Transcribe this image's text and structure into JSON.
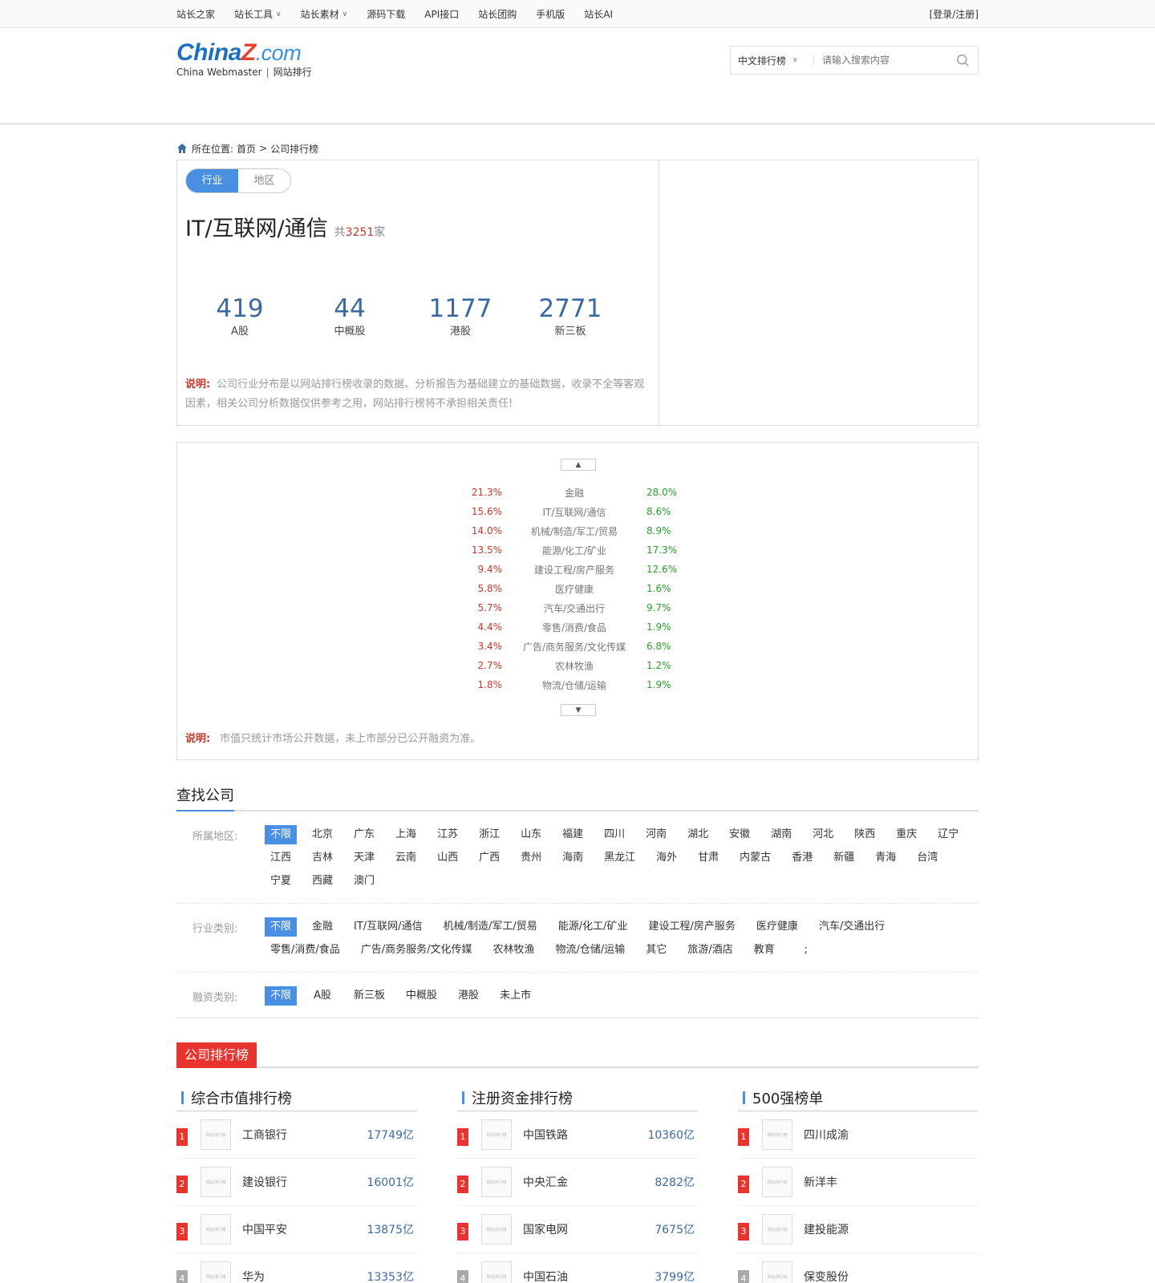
{
  "topnav": {
    "items": [
      {
        "label": "站长之家",
        "caret": false
      },
      {
        "label": "站长工具",
        "caret": true
      },
      {
        "label": "站长素材",
        "caret": true
      },
      {
        "label": "源码下载",
        "caret": false
      },
      {
        "label": "API接口",
        "caret": false
      },
      {
        "label": "站长团购",
        "caret": false
      },
      {
        "label": "手机版",
        "caret": false
      },
      {
        "label": "站长AI",
        "caret": false
      }
    ],
    "login": "[登录/注册]"
  },
  "logo": {
    "china": "China",
    "z": "Z",
    "dotcom": ".com",
    "sub_left": "China Webmaster",
    "sub_sep": "|",
    "sub_right": "网站排行"
  },
  "search": {
    "type": "中文排行榜",
    "placeholder": "请输入搜索内容"
  },
  "breadcrumb": {
    "prefix": "所在位置:",
    "home": "首页",
    "sep": ">",
    "current": "公司排行榜"
  },
  "summary": {
    "tabs": [
      {
        "label": "行业",
        "active": true
      },
      {
        "label": "地区",
        "active": false
      }
    ],
    "title": "IT/互联网/通信",
    "total_prefix": "共",
    "total_num": "3251",
    "total_suffix": "家",
    "stats": [
      {
        "value": "419",
        "label": "A股"
      },
      {
        "value": "44",
        "label": "中概股"
      },
      {
        "value": "1177",
        "label": "港股"
      },
      {
        "value": "2771",
        "label": "新三板"
      }
    ],
    "note_label": "说明:",
    "note_text": "公司行业分布是以网站排行榜收录的数据、分析报告为基础建立的基础数据，收录不全等客观因素，相关公司分析数据仅供参考之用，网站排行榜将不承担相关责任!"
  },
  "distribution": {
    "rows": [
      {
        "left": "21.3%",
        "name": "金融",
        "right": "28.0%"
      },
      {
        "left": "15.6%",
        "name": "IT/互联网/通信",
        "right": "8.6%"
      },
      {
        "left": "14.0%",
        "name": "机械/制造/军工/贸易",
        "right": "8.9%"
      },
      {
        "left": "13.5%",
        "name": "能源/化工/矿业",
        "right": "17.3%"
      },
      {
        "left": "9.4%",
        "name": "建设工程/房产服务",
        "right": "12.6%"
      },
      {
        "left": "5.8%",
        "name": "医疗健康",
        "right": "1.6%"
      },
      {
        "left": "5.7%",
        "name": "汽车/交通出行",
        "right": "9.7%"
      },
      {
        "left": "4.4%",
        "name": "零售/消费/食品",
        "right": "1.9%"
      },
      {
        "left": "3.4%",
        "name": "广告/商务服务/文化传媒",
        "right": "6.8%"
      },
      {
        "left": "2.7%",
        "name": "农林牧渔",
        "right": "1.2%"
      },
      {
        "left": "1.8%",
        "name": "物流/仓储/运输",
        "right": "1.9%"
      }
    ],
    "note_label": "说明:",
    "note_text": "市值只统计市场公开数据，未上市部分已公开融资为准。"
  },
  "find": {
    "title": "查找公司",
    "region_label": "所属地区:",
    "regions": [
      "不限",
      "北京",
      "广东",
      "上海",
      "江苏",
      "浙江",
      "山东",
      "福建",
      "四川",
      "河南",
      "湖北",
      "安徽",
      "湖南",
      "河北",
      "陕西",
      "重庆",
      "辽宁",
      "江西",
      "吉林",
      "天津",
      "云南",
      "山西",
      "广西",
      "贵州",
      "海南",
      "黑龙江",
      "海外",
      "甘肃",
      "内蒙古",
      "香港",
      "新疆",
      "青海",
      "台湾",
      "宁夏",
      "西藏",
      "澳门"
    ],
    "industry_label": "行业类别:",
    "industries": [
      "不限",
      "金融",
      "IT/互联网/通信",
      "机械/制造/军工/贸易",
      "能源/化工/矿业",
      "建设工程/房产服务",
      "医疗健康",
      "汽车/交通出行",
      "零售/消费/食品",
      "广告/商务服务/文化传媒",
      "农林牧渔",
      "物流/仓储/运输",
      "其它",
      "旅游/酒店",
      "教育",
      ";"
    ],
    "finance_label": "融资类别:",
    "finances": [
      "不限",
      "A股",
      "新三板",
      "中概股",
      "港股",
      "未上市"
    ]
  },
  "ranking": {
    "head": "公司排行榜",
    "thumb_text": "网站排行榜",
    "columns": [
      {
        "title": "综合市值排行榜",
        "rows": [
          {
            "rank": "1",
            "name": "工商银行",
            "value": "17749亿"
          },
          {
            "rank": "2",
            "name": "建设银行",
            "value": "16001亿"
          },
          {
            "rank": "3",
            "name": "中国平安",
            "value": "13875亿"
          },
          {
            "rank": "4",
            "name": "华为",
            "value": "13353亿"
          }
        ]
      },
      {
        "title": "注册资金排行榜",
        "rows": [
          {
            "rank": "1",
            "name": "中国铁路",
            "value": "10360亿"
          },
          {
            "rank": "2",
            "name": "中央汇金",
            "value": "8282亿"
          },
          {
            "rank": "3",
            "name": "国家电网",
            "value": "7675亿"
          },
          {
            "rank": "4",
            "name": "中国石油",
            "value": "3799亿"
          }
        ]
      },
      {
        "title": "500强榜单",
        "rows": [
          {
            "rank": "1",
            "name": "四川成渝",
            "value": ""
          },
          {
            "rank": "2",
            "name": "新洋丰",
            "value": ""
          },
          {
            "rank": "3",
            "name": "建投能源",
            "value": ""
          },
          {
            "rank": "4",
            "name": "保变股份",
            "value": ""
          }
        ]
      }
    ]
  },
  "colors": {
    "accent": "#4a90e2",
    "red": "#e8342e",
    "green": "#2a9d2a"
  }
}
